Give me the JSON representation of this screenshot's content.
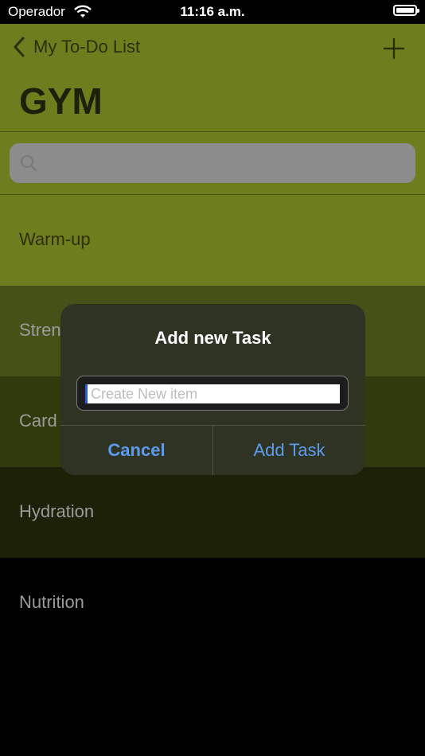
{
  "status_bar": {
    "carrier": "Operador",
    "time": "11:16 a.m."
  },
  "nav": {
    "back_label": "My To-Do List",
    "title": "GYM"
  },
  "list": {
    "rows": [
      {
        "label": "Warm-up",
        "color": "#6e7d1e"
      },
      {
        "label": "Stren",
        "color": "#445117"
      },
      {
        "label": "Card",
        "color": "#313a0d"
      },
      {
        "label": "Hydration",
        "color": "#1c2108"
      },
      {
        "label": "Nutrition",
        "color": "#000000"
      }
    ]
  },
  "dialog": {
    "title": "Add new Task",
    "field_placeholder": "Create New item",
    "cancel_label": "Cancel",
    "add_label": "Add Task"
  }
}
